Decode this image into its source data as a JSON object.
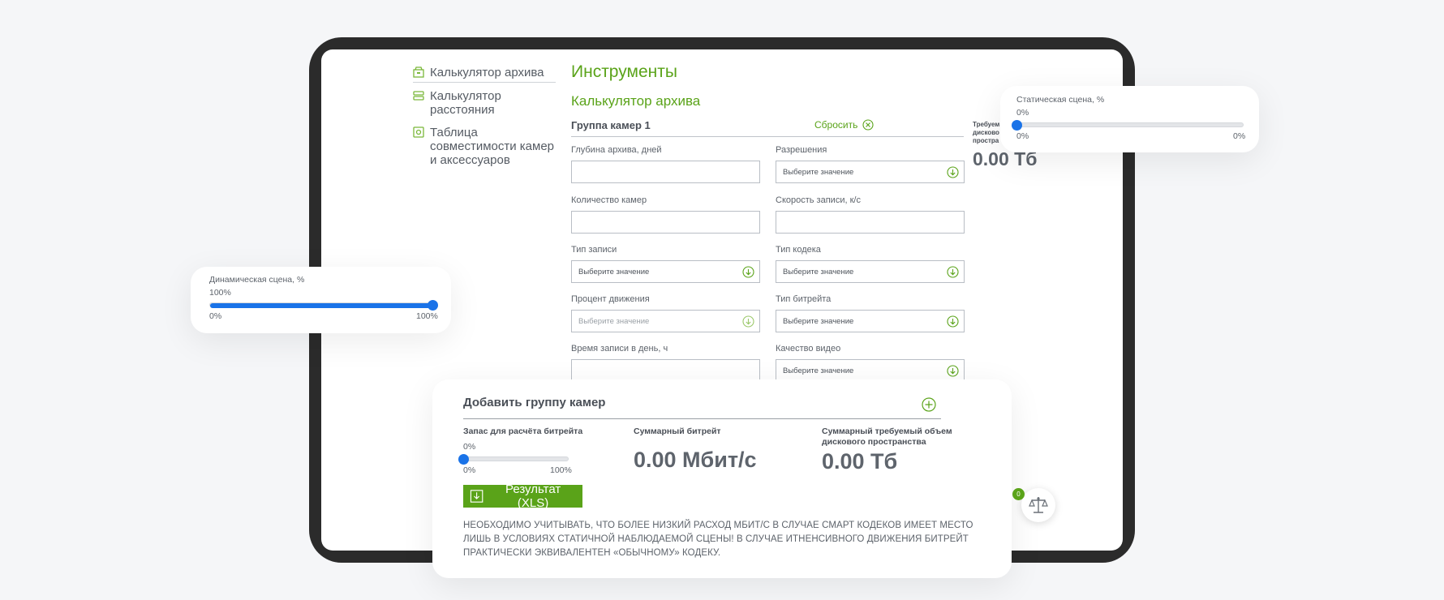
{
  "sidebar": {
    "items": [
      {
        "label": "Калькулятор архива",
        "icon": "archive-calculator-icon"
      },
      {
        "label": "Калькулятор расстояния",
        "icon": "distance-calculator-icon"
      },
      {
        "label": "Таблица совместимости камер и аксессуаров",
        "icon": "compatibility-table-icon"
      }
    ]
  },
  "main": {
    "title": "Инструменты",
    "subtitle": "Калькулятор архива",
    "group_title": "Группа камер 1",
    "reset_label": "Сбросить",
    "fields": {
      "archive_depth": {
        "label": "Глубина архива, дней",
        "value": ""
      },
      "resolution": {
        "label": "Разрешения",
        "value": "Выберите значение"
      },
      "camera_count": {
        "label": "Количество камер",
        "value": ""
      },
      "record_speed": {
        "label": "Скорость записи, к/с",
        "value": ""
      },
      "record_type": {
        "label": "Тип записи",
        "value": "Выберите значение"
      },
      "codec_type": {
        "label": "Тип кодека",
        "value": "Выберите значение"
      },
      "motion_percent": {
        "label": "Процент движения",
        "value": "Выберите значение"
      },
      "bitrate_type": {
        "label": "Тип битрейта",
        "value": "Выберите значение"
      },
      "record_hours": {
        "label": "Время записи в день, ч",
        "value": ""
      },
      "video_quality": {
        "label": "Качество видео",
        "value": "Выберите значение"
      }
    },
    "required_label_lines": [
      "Требуем",
      "дисково",
      "простра"
    ],
    "required_value": "0.00 Тб"
  },
  "static_scene": {
    "label": "Статическая сцена, %",
    "value": "0%",
    "min": "0%",
    "max": "0%",
    "level": 0
  },
  "dynamic_scene": {
    "label": "Динамическая сцена, %",
    "value": "100%",
    "min": "0%",
    "max": "100%",
    "level": 1
  },
  "summary": {
    "add_group_label": "Добавить группу камер",
    "reserve_label": "Запас для расчёта битрейта",
    "reserve_value": "0%",
    "reserve_min": "0%",
    "reserve_max": "100%",
    "reserve_level": 0,
    "bitrate_label": "Суммарный битрейт",
    "bitrate_value": "0.00 Мбит/с",
    "disk_label_line1": "Суммарный требуемый объем",
    "disk_label_line2": "дискового пространства",
    "disk_value": "0.00 Тб",
    "result_button": "Результат (XLS)",
    "note": "НЕОБХОДИМО УЧИТЫВАТЬ, ЧТО БОЛЕЕ НИЗКИЙ РАСХОД МБИТ/С В СЛУЧАЕ СМАРТ КОДЕКОВ ИМЕЕТ МЕСТО ЛИШЬ В УСЛОВИЯХ СТАТИЧНОЙ НАБЛЮДАЕМОЙ СЦЕНЫ! В СЛУЧАЕ ИТНЕНСИВНОГО ДВИЖЕНИЯ БИТРЕЙТ ПРАКТИЧЕСКИ ЭКВИВАЛЕНТЕН «ОБЫЧНОМУ» КОДЕКУ."
  },
  "compare": {
    "count": "0",
    "icon": "scales-icon"
  },
  "colors": {
    "accent_green": "#5aa319",
    "slider_blue": "#1a73e8",
    "tablet_frame": "#2b2b2b",
    "background": "#f5f6f8"
  }
}
